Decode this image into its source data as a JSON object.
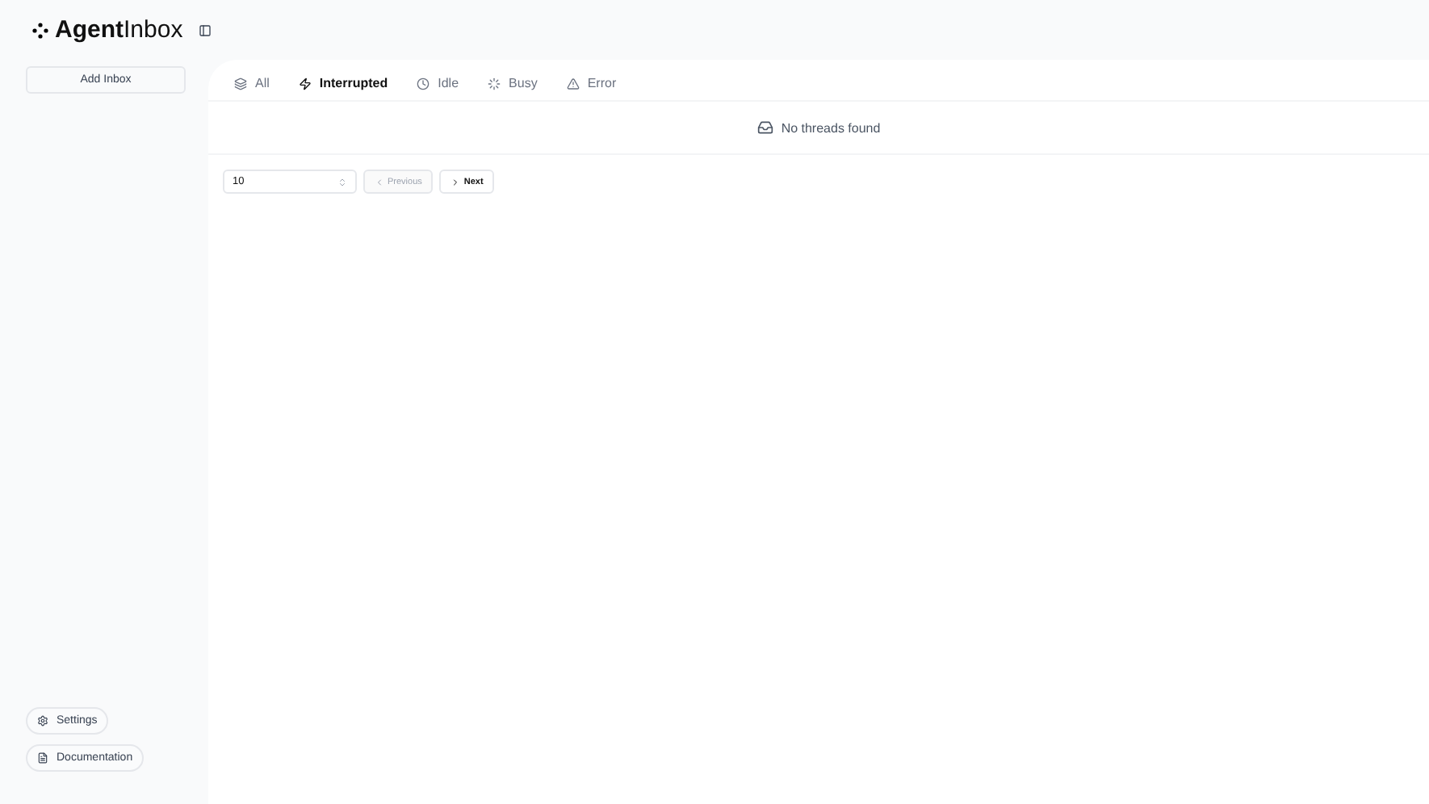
{
  "logo": {
    "text": "**Agent**Inbox"
  },
  "sidebar": {
    "add_button": "Add Inbox",
    "footer_items": [
      {
        "kind": "settings",
        "label": "Settings"
      },
      {
        "kind": "docs",
        "label": "Documentation"
      }
    ]
  },
  "tabs": [
    {
      "kind": "all",
      "label": "All",
      "selected": false
    },
    {
      "kind": "interrupted",
      "label": "Interrupted",
      "selected": true
    },
    {
      "kind": "idle",
      "label": "Idle",
      "selected": false
    },
    {
      "kind": "busy",
      "label": "Busy",
      "selected": false
    },
    {
      "kind": "error",
      "label": "Error",
      "selected": false
    }
  ],
  "empty_message": "No threads found",
  "pagination": {
    "page_size": "10",
    "previous": {
      "label": "Previous",
      "disabled": true
    },
    "next": {
      "label": "Next",
      "disabled": false
    }
  }
}
